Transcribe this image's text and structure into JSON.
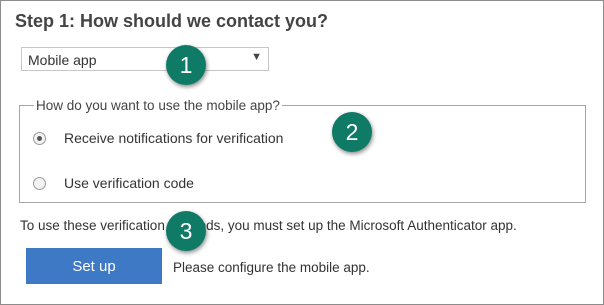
{
  "step": {
    "title": "Step 1: How should we contact you?"
  },
  "contact_method": {
    "selected": "Mobile app",
    "arrow_glyph": "▼"
  },
  "usage": {
    "legend": "How do you want to use the mobile app?",
    "options": [
      {
        "label": "Receive notifications for verification",
        "checked": true
      },
      {
        "label": "Use verification code",
        "checked": false
      }
    ]
  },
  "info_text": "To use these verification methods, you must set up the Microsoft Authenticator app.",
  "setup": {
    "button_label": "Set up",
    "status_text": "Please configure the mobile app."
  },
  "callouts": {
    "one": "1",
    "two": "2",
    "three": "3",
    "color": "#0f7a65"
  },
  "colors": {
    "button": "#3d79c4"
  }
}
